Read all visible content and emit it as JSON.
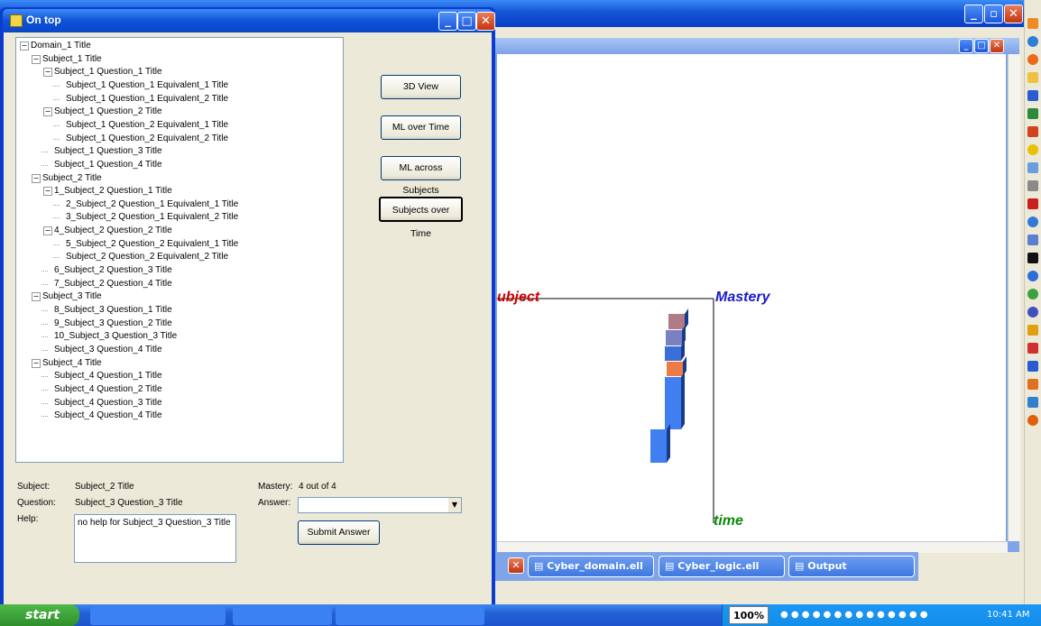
{
  "dialog": {
    "title": "On top",
    "tree": [
      {
        "level": 0,
        "label": "Domain_1 Title",
        "expanded": true
      },
      {
        "level": 1,
        "label": "Subject_1 Title",
        "expanded": true
      },
      {
        "level": 2,
        "label": "Subject_1 Question_1 Title",
        "expanded": true
      },
      {
        "level": 3,
        "label": "Subject_1 Question_1 Equivalent_1 Title"
      },
      {
        "level": 3,
        "label": "Subject_1 Question_1 Equivalent_2 Title"
      },
      {
        "level": 2,
        "label": "Subject_1 Question_2 Title",
        "expanded": true
      },
      {
        "level": 3,
        "label": "Subject_1 Question_2 Equivalent_1 Title"
      },
      {
        "level": 3,
        "label": "Subject_1 Question_2 Equivalent_2 Title"
      },
      {
        "level": 2,
        "label": "Subject_1 Question_3 Title"
      },
      {
        "level": 2,
        "label": "Subject_1 Question_4 Title"
      },
      {
        "level": 1,
        "label": "Subject_2 Title",
        "expanded": true
      },
      {
        "level": 2,
        "label": "1_Subject_2 Question_1 Title",
        "expanded": true
      },
      {
        "level": 3,
        "label": "2_Subject_2 Question_1 Equivalent_1 Title"
      },
      {
        "level": 3,
        "label": "3_Subject_2 Question_1 Equivalent_2 Title"
      },
      {
        "level": 2,
        "label": "4_Subject_2 Question_2 Title",
        "expanded": true
      },
      {
        "level": 3,
        "label": "5_Subject_2 Question_2 Equivalent_1 Title"
      },
      {
        "level": 3,
        "label": "Subject_2 Question_2 Equivalent_2 Title"
      },
      {
        "level": 2,
        "label": "6_Subject_2 Question_3 Title"
      },
      {
        "level": 2,
        "label": "7_Subject_2 Question_4 Title"
      },
      {
        "level": 1,
        "label": "Subject_3 Title",
        "expanded": true
      },
      {
        "level": 2,
        "label": "8_Subject_3 Question_1 Title"
      },
      {
        "level": 2,
        "label": "9_Subject_3 Question_2 Title"
      },
      {
        "level": 2,
        "label": "10_Subject_3 Question_3 Title"
      },
      {
        "level": 2,
        "label": "Subject_3 Question_4 Title"
      },
      {
        "level": 1,
        "label": "Subject_4 Title",
        "expanded": true
      },
      {
        "level": 2,
        "label": "Subject_4 Question_1 Title"
      },
      {
        "level": 2,
        "label": "Subject_4 Question_2 Title"
      },
      {
        "level": 2,
        "label": "Subject_4 Question_3 Title"
      },
      {
        "level": 2,
        "label": "Subject_4 Question_4 Title"
      }
    ],
    "buttons": {
      "view3d": "3D View",
      "ml_time": "ML over Time",
      "ml_subjects": "ML across Subjects",
      "subjects_time": "Subjects over Time",
      "submit": "Submit Answer"
    },
    "form": {
      "subject_label": "Subject:",
      "subject_value": "Subject_2 Title",
      "question_label": "Question:",
      "question_value": "Subject_3 Question_3 Title",
      "help_label": "Help:",
      "help_value": "no help for Subject_3 Question_3 Title",
      "mastery_label": "Mastery:",
      "mastery_value": "4 out of 4",
      "answer_label": "Answer:",
      "answer_value": ""
    }
  },
  "viewer": {
    "axis_subject": "ubject",
    "axis_mastery": "Mastery",
    "axis_time": "time",
    "bar_colors": [
      "#b07a86",
      "#7a80c0",
      "#3b6fd8",
      "#ee7a45",
      "#3f7ff0",
      "#3f7ff0"
    ]
  },
  "mdi_tabs": [
    {
      "label": "Cyber_domain.ell"
    },
    {
      "label": "Cyber_logic.ell"
    },
    {
      "label": "Output"
    }
  ],
  "taskbar": {
    "start": "start",
    "zoom": "100%",
    "clock": "10:41 AM"
  }
}
